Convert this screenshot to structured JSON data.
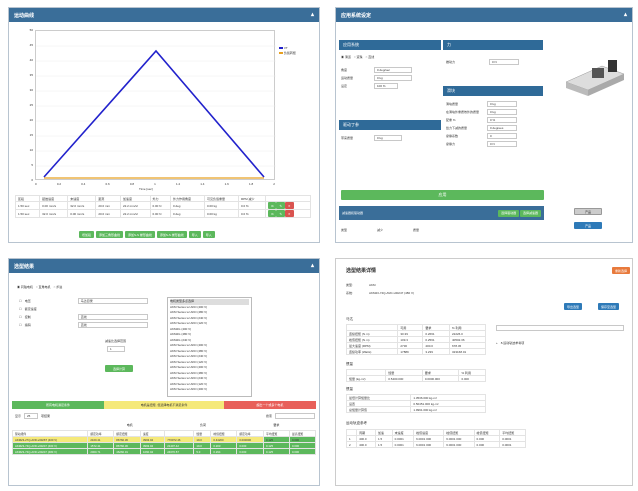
{
  "p1": {
    "title": "运动曲线",
    "legend": [
      {
        "name": "VT",
        "color": "#2222cc"
      },
      {
        "name": "负载转矩",
        "color": "#e8a020"
      }
    ],
    "xlabel": "Time [sec]",
    "yticks": [
      "50",
      "45",
      "40",
      "35",
      "30",
      "25",
      "20",
      "15",
      "10",
      "5",
      "0"
    ],
    "xticks": [
      "0",
      "0.2",
      "0.4",
      "0.6",
      "0.8",
      "1",
      "1.2",
      "1.4",
      "1.6",
      "1.8",
      "2"
    ],
    "headers": [
      "区段",
      "起始速度",
      "末速度",
      "距离",
      "加速度",
      "外力",
      "外力作用角度",
      "可见负载重量",
      "RPM 减少"
    ],
    "rows": [
      [
        "1.50 sec",
        "0.00 mm/s",
        "32.0 mm/s",
        "20.0 mm",
        "22.2 mm/s²",
        "0.00 N",
        "0 deg",
        "0.00 kg",
        "0.0 %"
      ],
      [
        "1.50 sec",
        "32.0 mm/s",
        "0.00 mm/s",
        "20.0 mm",
        "22.2 mm/s²",
        "0.00 N",
        "0 deg",
        "0.00 kg",
        "0.0 %"
      ]
    ],
    "buttons": [
      "增加段",
      "添加三角形曲线",
      "添加S-S 梯形曲线",
      "添加S-S 梯形曲线",
      "导入",
      "导入"
    ]
  },
  "p2": {
    "title": "应用系统设定",
    "s1": "应用系统",
    "s2": "力",
    "s3": "驱动丁参",
    "s4": "滑块",
    "radio": [
      "滑道",
      "滚珠",
      "直线"
    ],
    "f1": [
      {
        "l": "角度",
        "v": "0 deg/sec"
      },
      {
        "l": "运动质量",
        "v": "0 kg"
      },
      {
        "l": "设定",
        "v": "100 %"
      }
    ],
    "f2l": "推动力",
    "f2v": "0 N",
    "f3l": "带来质量",
    "f3v": "0 kg",
    "f4": [
      {
        "l": "滑块质量",
        "v": "0 kg"
      },
      {
        "l": "在滑块外重质效外的质量",
        "v": "0 kg"
      },
      {
        "l": "配重 %",
        "v": "0 %"
      },
      {
        "l": "给力下减的质量",
        "v": "0 degrees"
      },
      {
        "l": "摩擦系数",
        "v": "0"
      },
      {
        "l": "摩擦力",
        "v": "0 N"
      }
    ],
    "apply": "应用",
    "bar": "减速器和驱动器",
    "b1": "选择驱动器",
    "b2": "选择减速器",
    "t1": "类型",
    "t2": "减少",
    "t3": "质量",
    "side1": "产品",
    "side2": "产品"
  },
  "p3": {
    "title": "选型结果",
    "radio": [
      "同轴电机",
      "直角电机",
      "步进"
    ],
    "opts": [
      "电压",
      "额定速度",
      "控制",
      "编码"
    ],
    "lab": "马达目录",
    "sel": "直线",
    "ratio": "减速比选择范围",
    "ratiov": "1",
    "calc": "选择计算",
    "list": [
      "电机类型多点选择",
      "AKM Series w/ AKD (400 V)",
      "AKM Series w/ AKD (480 V)",
      "AKM Series w/ AKD (240 V)",
      "AKM Series w/ AKD (120 V)",
      "AKM2G (400 V)",
      "AKM2G (480 V)",
      "AKM2G (240 V)",
      "AKM Series w/ AKD (400 V)",
      "AKM Series w/ AKD (480 V)",
      "AKM Series w/ AKD (240 V)",
      "AKM Series w/ AKD (120 V)",
      "AKM Series w/ AKD (400 V)",
      "AKM Series w/ AKD (480 V)",
      "AKM Series w/ AKD (240 V)",
      "AKM Series w/ AKD (120 V)",
      "AKM Series w/ AKD (400 V)"
    ],
    "legend": [
      "所有电机满足条件",
      "电机是扭矩, 但选择电机不满足条件",
      "超出一个或多个电机"
    ],
    "show": "显示",
    "show_n": "25",
    "records": "项结果",
    "search": "搜索",
    "g": [
      "电机",
      "负荷",
      "要求"
    ],
    "hdr": [
      "驱动组件",
      "额定功率",
      "额定扭矩",
      "速度",
      "峰值扭矩",
      "惯量",
      "额定功率",
      "平均扭矩",
      "最高扭矩"
    ],
    "rows": [
      [
        "AKM23-27Q-AVD-v0026T (400 V)",
        "2100.41",
        "86760.36",
        "3993.04",
        "770072.46",
        "19.0",
        "0.44200",
        "0.000000",
        "0.125",
        "0.000"
      ],
      [
        "AKM23-74Q-AVD-v00247 (400 V)",
        "1572.41",
        "86760.36",
        "3993.04",
        "21407.42",
        "19.0",
        "0.203",
        "0.000",
        "0.125",
        "0.000"
      ],
      [
        "AKM23-74Q-AVD-v00247 (480 V)",
        "2000.71",
        "46260.01",
        "1060.04",
        "24670.57",
        "5.0",
        "0.294",
        "0.000",
        "0.125",
        "0.000"
      ]
    ]
  },
  "p4": {
    "title": "选型结果详情",
    "btn": "重新选择",
    "b1": "导出选型",
    "b2": "保存至选型",
    "i1l": "类型:",
    "i1v": "AKM",
    "i2l": "系统:",
    "i2v": "AKM23-74Q-AVD-v00247 (480 V)",
    "s1": "马达",
    "h1": [
      "",
      "可用",
      "要求",
      "% 利用"
    ],
    "r1": [
      [
        "连续扭矩 (N·m)",
        "30.39",
        "0.2661",
        "22226.0"
      ],
      [
        "峰值扭矩 (N·m)",
        "109.3",
        "0.2561",
        "40502.36"
      ],
      [
        "最大速度 (RPM)",
        "2730",
        "400.0",
        "678.45"
      ],
      [
        "连续功率 (Watts)",
        "17889",
        "3.239",
        "323168.01"
      ]
    ],
    "s2": "惯量",
    "h2": [
      "",
      "惯量",
      "要求",
      "% 利用"
    ],
    "r2": [
      [
        "惯量 (kg-m²)",
        "0.5400.000",
        "0.0000.000",
        "0.000"
      ]
    ],
    "s3": "惯量",
    "kv": [
      {
        "k": "最低计算惯量比",
        "v": "1.3536.000 kg-m²"
      },
      {
        "k": "设置",
        "v": "0.50451.000 kg-m²"
      },
      {
        "k": "总惯量计算值",
        "v": "1.9991.000 kg-m²"
      }
    ],
    "s4": "运动轨迹参考",
    "h4": [
      "",
      "周期",
      "加速",
      "末速度",
      "峰值速度",
      "峰值扭矩",
      "峰值扭矩",
      "平均扭矩"
    ],
    "r4": [
      [
        "1",
        "400.0",
        "1.5",
        "0.0001",
        "6.0001 000",
        "6.0001 000",
        "0.000",
        "0.0001"
      ],
      [
        "2",
        "400.0",
        "1.5",
        "0.0001",
        "6.0001 000",
        "6.0001 000",
        "0.000",
        "0.0001"
      ]
    ],
    "right_item": "8.运动轨迹参考项"
  }
}
